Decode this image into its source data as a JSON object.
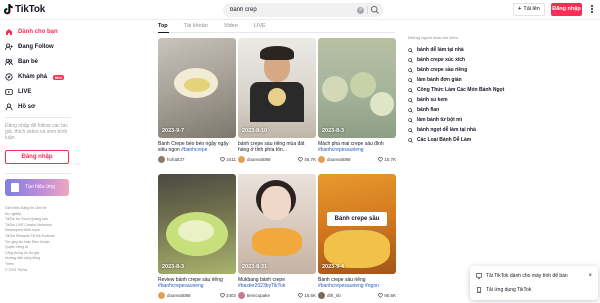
{
  "header": {
    "logo_text": "TikTok",
    "search_value": "bánh crep",
    "upload_label": "Tải lên",
    "login_label": "Đăng nhập"
  },
  "sidebar": {
    "items": [
      {
        "label": "Dành cho bạn",
        "icon": "home-icon"
      },
      {
        "label": "Đang Follow",
        "icon": "following-icon"
      },
      {
        "label": "Bạn bè",
        "icon": "friends-icon"
      },
      {
        "label": "Khám phá",
        "icon": "compass-icon",
        "badge": "Mới"
      },
      {
        "label": "LIVE",
        "icon": "live-icon"
      },
      {
        "label": "Hồ sơ",
        "icon": "profile-icon"
      }
    ],
    "login_hint": "Đăng nhập để follow các tác giả, thích video và xem bình luận.",
    "login_button": "Đăng nhập",
    "effect_card_label": "Tạo hiệu ứng",
    "footer_links": [
      "Giới thiệu   Bảng tin   Liên hệ",
      "Sự nghiệp",
      "TikTok for Good   Quảng cáo",
      "TikTok LIVE Creator Networks",
      "Developers   Minh bạch",
      "TikTok Rewards   TikTok Embeds",
      "Trợ giúp   An toàn   Điều khoản",
      "Quyền riêng tư",
      "Cổng thông tin Sự giả",
      "Hướng dẫn cộng đồng",
      "Thêm",
      "© 2024 TikTok"
    ]
  },
  "tabs": [
    "Top",
    "Tài khoản",
    "Video",
    "LIVE"
  ],
  "videos": [
    {
      "date": "2023-9-7",
      "caption": "Bánh Crepe béo béo ngậy ngậy siêu ngon ",
      "tag": "#banhcrepe",
      "author": "hohatt37",
      "likes": "2411"
    },
    {
      "date": "2023-8-10",
      "caption": "bánh crepe sầu riêng mùa đất hàng ở tỉnh phía tôn...",
      "tag": "",
      "author": "doanvat088",
      "likes": "45.7K"
    },
    {
      "date": "2023-8-3",
      "caption": "Mách pha mai crepe sầu đỉnh ",
      "tag": "#banhcrepesaurieng",
      "author": "doanvat088",
      "likes": "15.7K"
    },
    {
      "date": "2023-8-3",
      "caption": "Review bánh crepe sầu riêng ",
      "tag": "#banhcrepesaurieng",
      "author": "doanvat088",
      "likes": "2402"
    },
    {
      "date": "2023-8-31",
      "caption": "Mukbang bánh crepe ",
      "tag": "#baster2023byTikTok",
      "author": "tiemcupake",
      "likes": "15.6K"
    },
    {
      "date": "2023-9-4",
      "caption": "Bánh crepe sầu riêng ",
      "tag": "#banhcrepesaurieng #ngon",
      "author": "dth_nb",
      "likes": "90.6K",
      "overlay": "Bánh crepe sầu"
    }
  ],
  "related": {
    "title": "Những người khác tìm kiếm",
    "items": [
      "bánh dễ làm tại nhà",
      "bánh crepe xúc xích",
      "bánh crepe sầu riêng",
      "làm bánh đơn giản",
      "Công Thức Làm Các Món Bánh Ngọt",
      "bánh su kem",
      "bánh flan",
      "làm bánh từ bột mì",
      "bánh ngọt dễ làm tại nhà",
      "Các Loại Bánh Dễ Làm"
    ]
  },
  "toast": {
    "primary": "Tải TikTok dành cho máy tính để bàn",
    "secondary": "Tải ứng dụng TikTok"
  },
  "colors": {
    "accent": "#fe2c55",
    "hashtag": "#2b5db9"
  }
}
